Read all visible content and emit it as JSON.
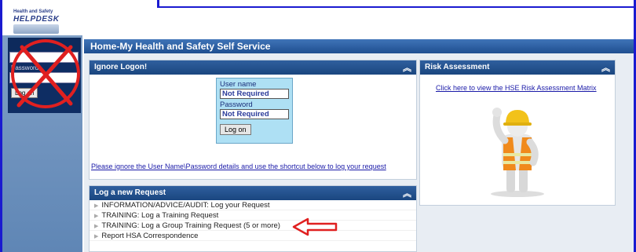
{
  "logo": {
    "line1": "Health and Safety",
    "line2": "HELPDESK"
  },
  "left_panel": {
    "username_label": "",
    "password_label": "Password",
    "logon_label": "Log on"
  },
  "banner": {
    "title": "Home-My Health and Safety Self Service"
  },
  "ignore_panel": {
    "title": "Ignore Logon!",
    "username_label": "User name",
    "username_value": "Not Required",
    "password_label": "Password",
    "password_value": "Not Required",
    "logon_button": "Log on",
    "note_link": "Please ignore the User Name\\Password details and use the shortcut below to log your request"
  },
  "request_panel": {
    "title": "Log a new Request",
    "items": [
      "INFORMATION/ADVICE/AUDIT: Log your Request",
      "TRAINING: Log a Training Request",
      "TRAINING: Log a Group Training Request (5 or more)",
      "Report HSA Correspondence"
    ]
  },
  "risk_panel": {
    "title": "Risk Assessment",
    "link": "Click here to view the HSE Risk Assessment Matrix"
  },
  "icons": {
    "collapse": "chevron-double-up-icon",
    "list_bullet": "triangle-right-icon",
    "annotation_arrow": "red-arrow-left-icon",
    "cross_out": "red-x-circle-icon"
  },
  "colors": {
    "banner": "#2a5ea4",
    "panel_header": "#1f4f8a",
    "mini_login_bg": "#aee0f4",
    "annotation_red": "#e02020",
    "frame_blue": "#1a1ad0"
  }
}
